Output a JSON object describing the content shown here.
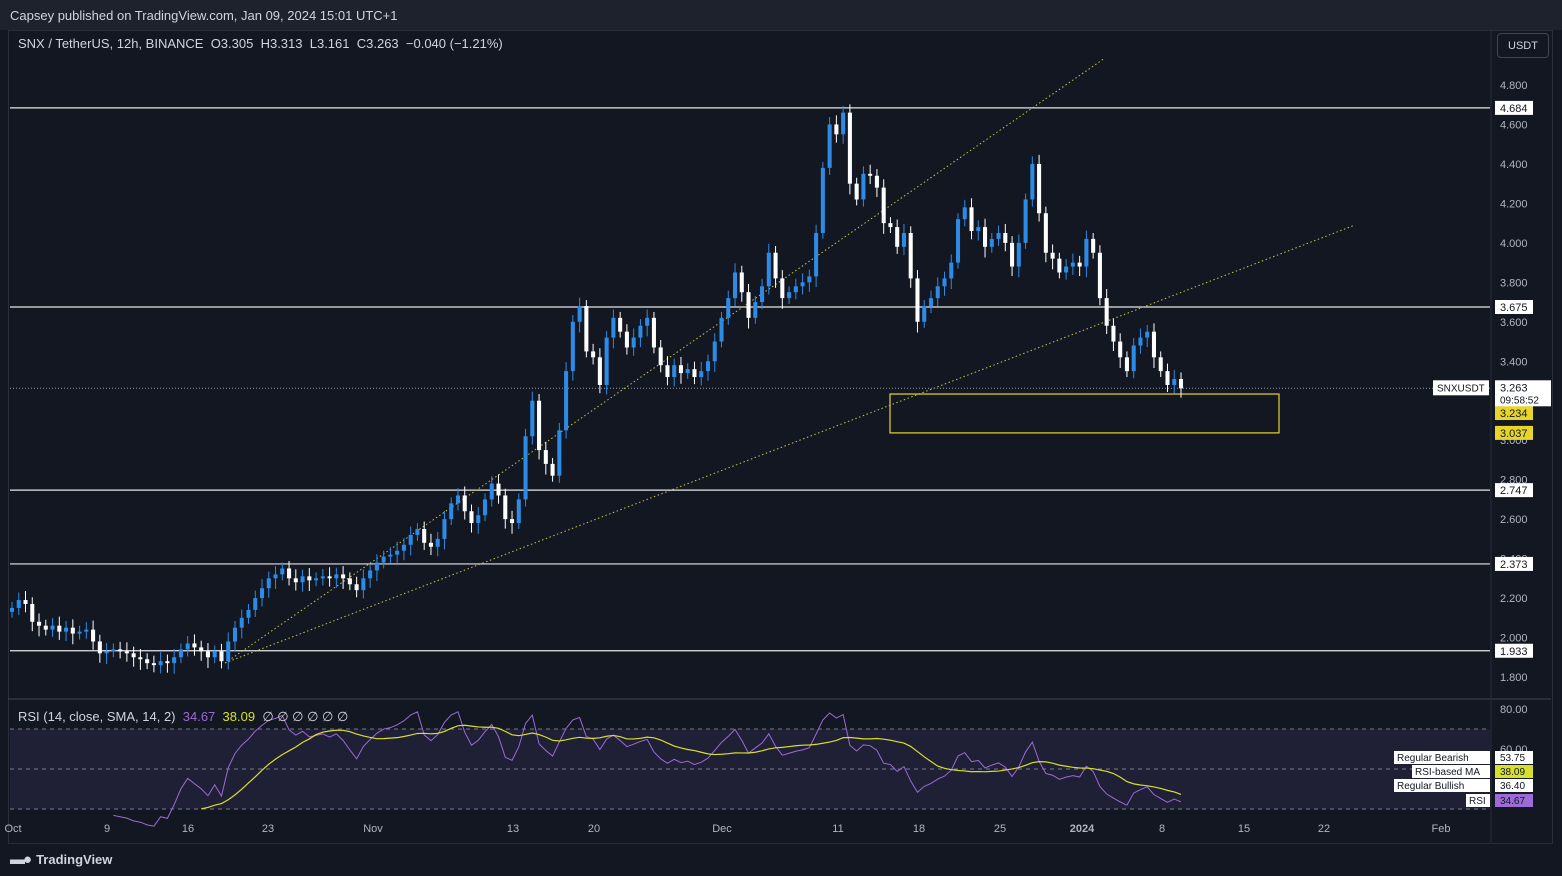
{
  "publisher": "Capsey published on TradingView.com, Jan 09, 2024 15:01 UTC+1",
  "legend": {
    "symbol": "SNX / TetherUS, 12h, BINANCE",
    "open": "O3.305",
    "high": "H3.313",
    "low": "L3.161",
    "close": "C3.263",
    "change": "−0.040 (−1.21%)"
  },
  "currency_button": "USDT",
  "rsi_legend": {
    "label": "RSI (14, close, SMA, 14, 2)",
    "rsi": "34.67",
    "ma": "38.09",
    "extras": "∅ ∅ ∅ ∅ ∅ ∅"
  },
  "footer_brand": "TradingView",
  "colors": {
    "up": "#2d8be6",
    "down": "#ffffff",
    "background": "#131722",
    "trendline": "#c9c24a",
    "zone": "#e8d52a",
    "rsi": "#9c6bd6",
    "rsi_ma": "#d7e02b"
  },
  "chart_data": [
    {
      "type": "candlestick",
      "title": "SNX / TetherUS, 12h, BINANCE",
      "current_price_label": "SNXUSDT",
      "current_price": "3.263",
      "countdown": "09:58:52",
      "yticks": [
        "4.800",
        "4.600",
        "4.400",
        "4.200",
        "4.000",
        "3.800",
        "3.600",
        "3.400",
        "3.000",
        "2.800",
        "2.600",
        "2.400",
        "2.200",
        "2.000",
        "1.800"
      ],
      "ylim": [
        1.74,
        4.96
      ],
      "xticks": [
        "Oct",
        "9",
        "16",
        "23",
        "Nov",
        "13",
        "20",
        "Dec",
        "11",
        "18",
        "25",
        "2024",
        "8",
        "15",
        "22",
        "Feb"
      ],
      "horizontal_levels": [
        "4.684",
        "3.675",
        "2.747",
        "2.373",
        "1.933"
      ],
      "zone": {
        "top": "3.234",
        "bottom": "3.037",
        "color": "#e8d52a"
      },
      "trendlines": [
        {
          "from": [
            "Oct 21",
            1.86
          ],
          "to": [
            "Jan 1",
            4.92
          ]
        },
        {
          "from": [
            "Oct 21",
            1.86
          ],
          "to": [
            "Jan 21",
            4.09
          ]
        }
      ],
      "closes": [
        2.15,
        2.19,
        2.17,
        2.08,
        2.06,
        2.04,
        2.06,
        2.03,
        2.05,
        2.02,
        2.03,
        2.04,
        1.98,
        1.92,
        1.93,
        1.94,
        1.93,
        1.92,
        1.9,
        1.89,
        1.87,
        1.86,
        1.88,
        1.87,
        1.9,
        1.94,
        1.97,
        1.95,
        1.93,
        1.9,
        1.93,
        1.88,
        1.98,
        2.05,
        2.1,
        2.14,
        2.2,
        2.25,
        2.3,
        2.32,
        2.35,
        2.3,
        2.28,
        2.31,
        2.29,
        2.3,
        2.31,
        2.3,
        2.32,
        2.3,
        2.27,
        2.24,
        2.3,
        2.34,
        2.38,
        2.41,
        2.42,
        2.44,
        2.47,
        2.52,
        2.55,
        2.48,
        2.46,
        2.5,
        2.6,
        2.68,
        2.72,
        2.64,
        2.58,
        2.62,
        2.7,
        2.78,
        2.72,
        2.6,
        2.58,
        2.7,
        3.02,
        3.2,
        2.95,
        2.88,
        2.82,
        3.05,
        3.35,
        3.6,
        3.68,
        3.45,
        3.42,
        3.28,
        3.52,
        3.62,
        3.55,
        3.47,
        3.52,
        3.58,
        3.62,
        3.47,
        3.38,
        3.32,
        3.38,
        3.34,
        3.36,
        3.32,
        3.35,
        3.4,
        3.5,
        3.62,
        3.72,
        3.85,
        3.75,
        3.62,
        3.7,
        3.78,
        3.95,
        3.82,
        3.72,
        3.75,
        3.78,
        3.8,
        3.83,
        4.05,
        4.38,
        4.6,
        4.55,
        4.66,
        4.3,
        4.22,
        4.35,
        4.34,
        4.28,
        4.1,
        4.08,
        3.98,
        4.05,
        3.82,
        3.6,
        3.68,
        3.72,
        3.78,
        3.82,
        3.9,
        4.12,
        4.18,
        4.06,
        4.08,
        3.98,
        4.02,
        4.05,
        4.0,
        3.88,
        4.0,
        4.22,
        4.4,
        4.15,
        3.95,
        3.92,
        3.85,
        3.88,
        3.9,
        3.88,
        4.02,
        3.95,
        3.72,
        3.58,
        3.5,
        3.42,
        3.35,
        3.48,
        3.52,
        3.55,
        3.42,
        3.35,
        3.28,
        3.31,
        3.263
      ],
      "rsi": {
        "yticks": [
          "80.00",
          "60.00"
        ],
        "levels": {
          "upper": 70,
          "middle": 50,
          "lower": 30
        },
        "labels": [
          {
            "name": "Regular Bearish",
            "value": "53.75"
          },
          {
            "name": "RSI-based MA",
            "value": "38.09"
          },
          {
            "name": "Regular Bullish",
            "value": "36.40"
          },
          {
            "name": "RSI",
            "value": "34.67"
          }
        ]
      }
    }
  ]
}
